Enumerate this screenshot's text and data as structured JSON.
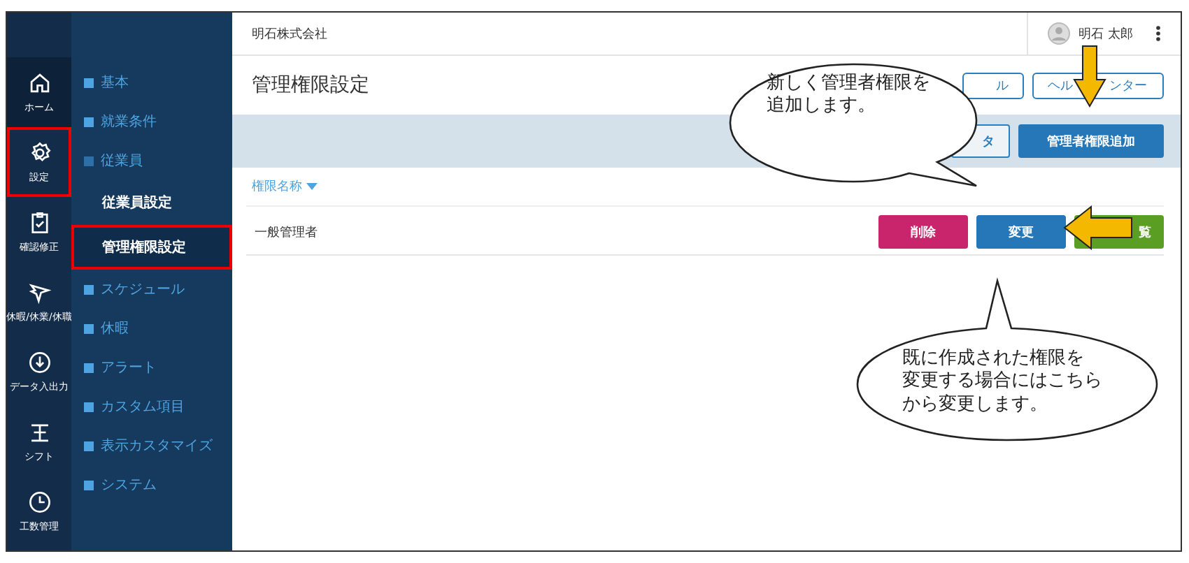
{
  "header": {
    "company": "明石株式会社",
    "user": "明石 太郎"
  },
  "rail": [
    {
      "label": "ホーム",
      "selected": true,
      "highlighted": false
    },
    {
      "label": "設定",
      "selected": false,
      "highlighted": true
    },
    {
      "label": "確認修正",
      "selected": false,
      "highlighted": false
    },
    {
      "label": "休暇/休業/休職",
      "selected": false,
      "highlighted": false
    },
    {
      "label": "データ入出力",
      "selected": false,
      "highlighted": false
    },
    {
      "label": "シフト",
      "selected": false,
      "highlighted": false
    },
    {
      "label": "工数管理",
      "selected": false,
      "highlighted": false
    }
  ],
  "menu": [
    {
      "label": "基本",
      "expanded": false
    },
    {
      "label": "就業条件",
      "expanded": false
    },
    {
      "label": "従業員",
      "expanded": true,
      "children": [
        {
          "label": "従業員設定",
          "selected": false,
          "highlighted": false
        },
        {
          "label": "管理権限設定",
          "selected": true,
          "highlighted": true
        }
      ]
    },
    {
      "label": "スケジュール",
      "expanded": false
    },
    {
      "label": "休暇",
      "expanded": false
    },
    {
      "label": "アラート",
      "expanded": false
    },
    {
      "label": "カスタム項目",
      "expanded": false
    },
    {
      "label": "表示カスタマイズ",
      "expanded": false
    },
    {
      "label": "システム",
      "expanded": false
    }
  ],
  "page": {
    "title": "管理権限設定",
    "header_buttons": [
      {
        "parts": [
          "ル"
        ]
      },
      {
        "parts": [
          "ヘル",
          "ンター"
        ]
      }
    ],
    "toolbar_buttons": [
      {
        "label": "タ",
        "kind": "outline"
      },
      {
        "label": "管理者権限追加",
        "kind": "primary"
      }
    ],
    "column": "権限名称",
    "rows": [
      {
        "name": "一般管理者",
        "actions": [
          {
            "label": "削除",
            "kind": "danger"
          },
          {
            "label": "変更",
            "kind": "primary"
          },
          {
            "label": "覧",
            "kind": "success"
          }
        ]
      }
    ]
  },
  "callouts": [
    {
      "lines": [
        "新しく管理者権限を",
        "追加します。"
      ]
    },
    {
      "lines": [
        "既に作成された権限を",
        "変更する場合にはこちら",
        "から変更します。"
      ]
    }
  ]
}
